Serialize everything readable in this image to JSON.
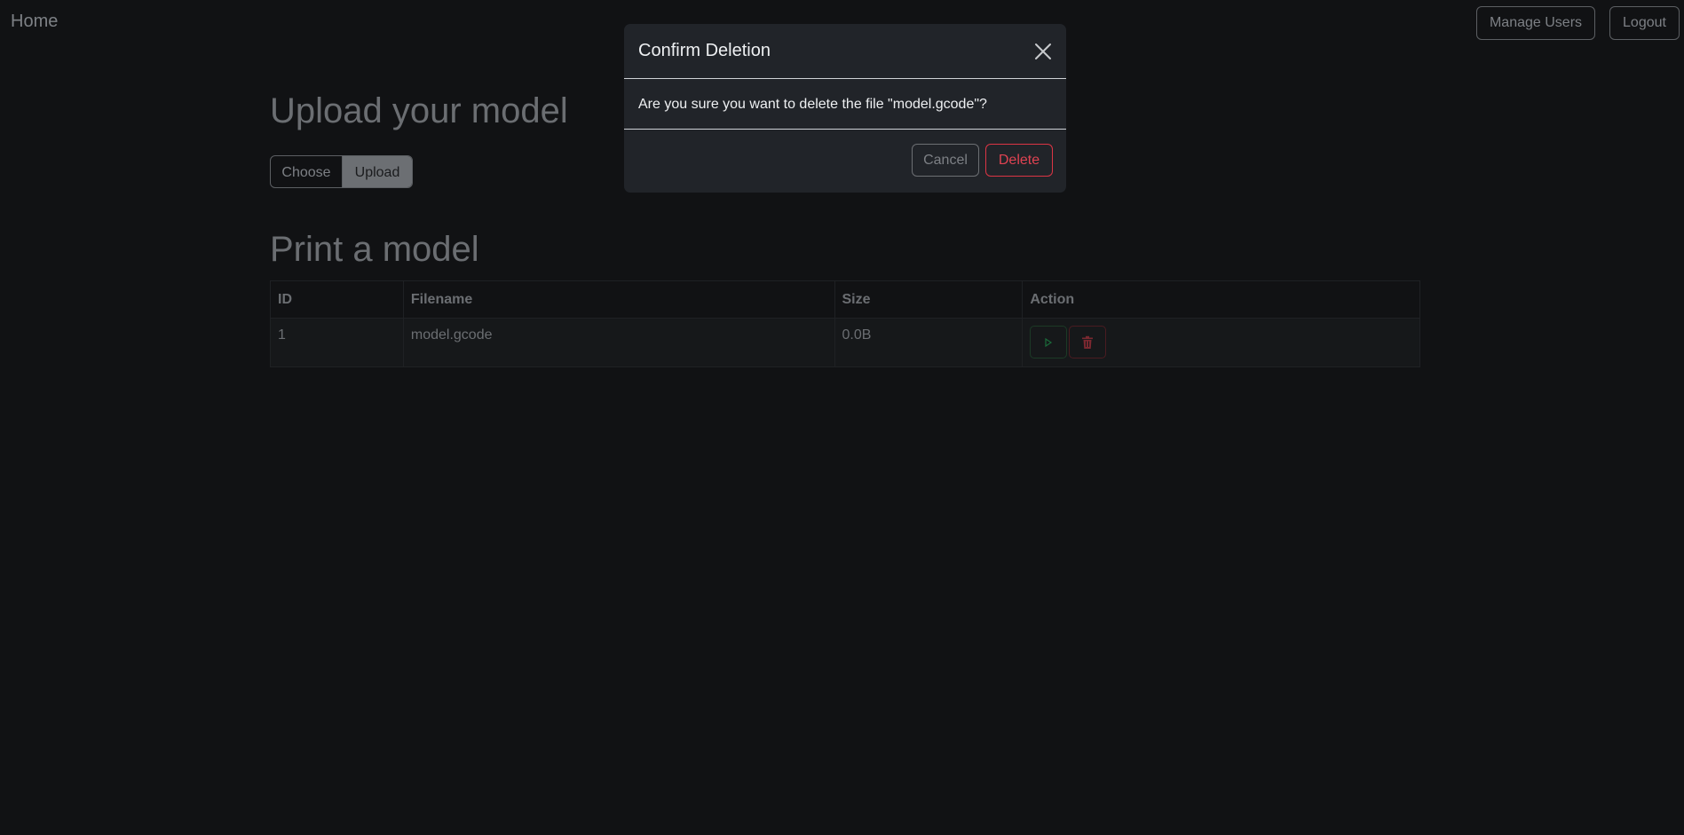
{
  "navbar": {
    "brand": "Home",
    "manage_users_label": "Manage Users",
    "logout_label": "Logout"
  },
  "upload": {
    "title": "Upload your model",
    "choose_label": "Choose",
    "upload_label": "Upload"
  },
  "print": {
    "title": "Print a model",
    "columns": [
      "ID",
      "Filename",
      "Size",
      "Action"
    ],
    "rows": [
      {
        "id": "1",
        "filename": "model.gcode",
        "size": "0.0B"
      }
    ],
    "row_actions": {
      "print_icon": "play-icon",
      "delete_icon": "trash-icon"
    }
  },
  "modal": {
    "title": "Confirm Deletion",
    "message": "Are you sure you want to delete the file \"model.gcode\"?",
    "cancel_label": "Cancel",
    "delete_label": "Delete",
    "close_icon": "close-icon"
  },
  "colors": {
    "background": "#111214",
    "modal_background": "#212429",
    "danger": "#dc3545",
    "success": "#198754"
  }
}
